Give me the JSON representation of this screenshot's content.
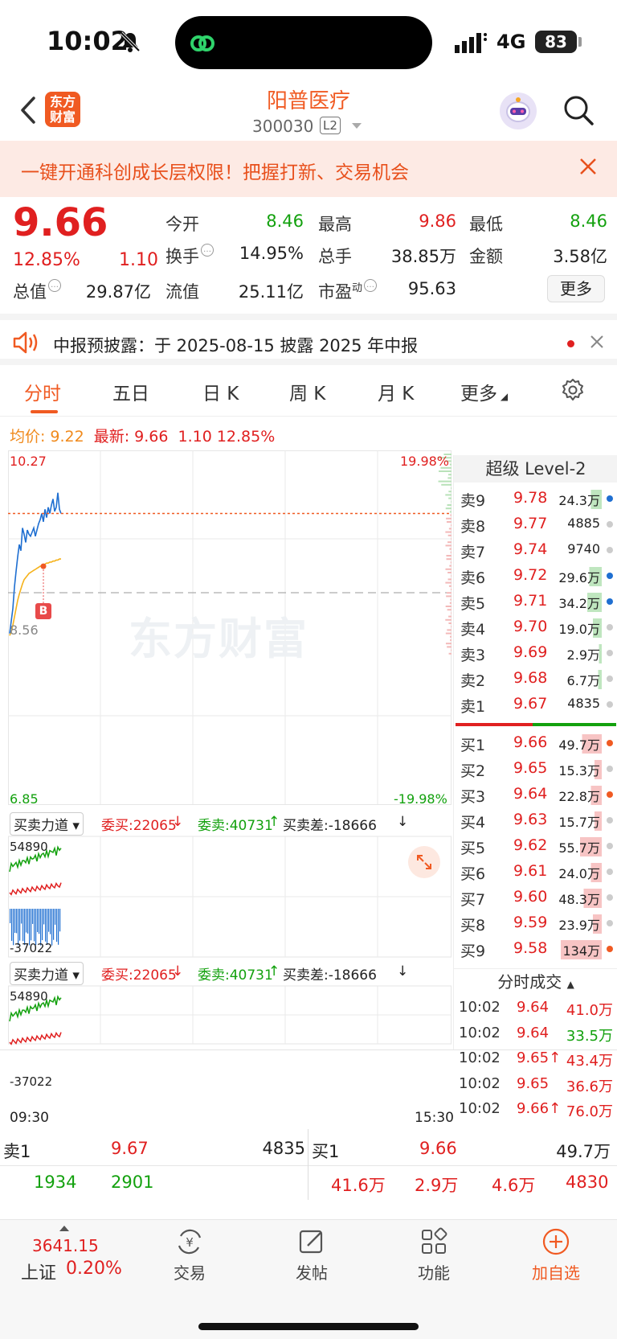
{
  "status": {
    "time": "10:02",
    "network": "4G",
    "battery": "83"
  },
  "header": {
    "logo_text": "东方财富",
    "stock_name": "阳普医疗",
    "stock_code": "300030",
    "level_tag": "L2"
  },
  "banner": {
    "text": "一键开通科创成长层权限！把握打新、交易机会"
  },
  "quote": {
    "price": "9.66",
    "change_pct": "12.85%",
    "change": "1.10",
    "open_label": "今开",
    "open": "8.46",
    "high_label": "最高",
    "high": "9.86",
    "low_label": "最低",
    "low": "8.46",
    "turnover_label": "换手",
    "turnover": "14.95%",
    "volume_label": "总手",
    "volume": "38.85万",
    "amount_label": "金额",
    "amount": "3.58亿",
    "mktcap_label": "总值",
    "mktcap": "29.87亿",
    "float_label": "流值",
    "float": "25.11亿",
    "pe_label": "市盈",
    "pe_sup": "动",
    "pe": "95.63",
    "more_label": "更多"
  },
  "notice": {
    "text": "中报预披露：于 2025-08-15 披露 2025 年中报"
  },
  "tabs": [
    "分时",
    "五日",
    "日 K",
    "周 K",
    "月 K",
    "更多"
  ],
  "avgline": {
    "avg_label": "均价:",
    "avg": "9.22",
    "last_label": "最新:",
    "last": "9.66",
    "chg": "1.10",
    "pct": "12.85%"
  },
  "chart": {
    "ymax": "10.27",
    "ymin": "6.85",
    "ymid": "8.56",
    "pct_max": "19.98%",
    "pct_min": "-19.98%",
    "watermark": "东方财富",
    "buy_marker": "B",
    "time_start": "09:30",
    "time_end": "15:30",
    "indicator": {
      "name": "买卖力道",
      "buy": "委买:22065",
      "sell": "委卖:40731",
      "diff": "买卖差:-18666",
      "top": "54890",
      "bottom": "-37022"
    }
  },
  "chart_data": {
    "type": "line",
    "x": [
      "09:30",
      "09:31",
      "09:32",
      "09:33",
      "09:34",
      "09:35",
      "09:36",
      "09:37",
      "09:38",
      "09:39",
      "09:40",
      "09:41",
      "09:42",
      "09:43",
      "09:44",
      "09:45",
      "09:46",
      "09:47",
      "09:48",
      "09:49",
      "09:50",
      "09:51",
      "09:52",
      "09:53",
      "09:54",
      "09:55",
      "09:56",
      "09:57",
      "09:58",
      "09:59",
      "10:00",
      "10:01",
      "10:02"
    ],
    "series": [
      {
        "values": [
          8.5,
          8.62,
          8.74,
          8.95,
          9.1,
          9.24,
          9.36,
          9.3,
          9.52,
          9.46,
          9.38,
          9.5,
          9.46,
          9.44,
          9.48,
          9.52,
          9.44,
          9.5,
          9.56,
          9.6,
          9.66,
          9.58,
          9.7,
          9.62,
          9.72,
          9.66,
          9.74,
          9.8,
          9.68,
          9.72,
          9.86,
          9.7,
          9.66
        ]
      },
      {
        "values": [
          8.48,
          8.52,
          8.58,
          8.66,
          8.74,
          8.82,
          8.88,
          8.93,
          8.98,
          9.02,
          9.04,
          9.06,
          9.08,
          9.09,
          9.1,
          9.11,
          9.12,
          9.13,
          9.14,
          9.15,
          9.15,
          9.16,
          9.17,
          9.18,
          9.18,
          9.19,
          9.19,
          9.2,
          9.2,
          9.21,
          9.21,
          9.22,
          9.22
        ]
      }
    ],
    "ylim": [
      6.85,
      10.27
    ]
  },
  "level2": {
    "title": "超级 Level-2",
    "asks": [
      {
        "label": "卖9",
        "price": "9.78",
        "vol": "24.3万",
        "bar": 0.12,
        "dot": "#1f6fd1"
      },
      {
        "label": "卖8",
        "price": "9.77",
        "vol": "4885",
        "bar": 0,
        "dot": "#cccccc"
      },
      {
        "label": "卖7",
        "price": "9.74",
        "vol": "9740",
        "bar": 0,
        "dot": "#cccccc"
      },
      {
        "label": "卖6",
        "price": "9.72",
        "vol": "29.6万",
        "bar": 0.14,
        "dot": "#1f6fd1"
      },
      {
        "label": "卖5",
        "price": "9.71",
        "vol": "34.2万",
        "bar": 0.16,
        "dot": "#1f6fd1"
      },
      {
        "label": "卖4",
        "price": "9.70",
        "vol": "19.0万",
        "bar": 0.1,
        "dot": "#cccccc"
      },
      {
        "label": "卖3",
        "price": "9.69",
        "vol": "2.9万",
        "bar": 0.04,
        "dot": "#cccccc"
      },
      {
        "label": "卖2",
        "price": "9.68",
        "vol": "6.7万",
        "bar": 0.05,
        "dot": "#cccccc"
      },
      {
        "label": "卖1",
        "price": "9.67",
        "vol": "4835",
        "bar": 0,
        "dot": "#cccccc"
      }
    ],
    "bids": [
      {
        "label": "买1",
        "price": "9.66",
        "vol": "49.7万",
        "bar": 0.22,
        "dot": "#f05a22"
      },
      {
        "label": "买2",
        "price": "9.65",
        "vol": "15.3万",
        "bar": 0.08,
        "dot": "#cccccc"
      },
      {
        "label": "买3",
        "price": "9.64",
        "vol": "22.8万",
        "bar": 0.12,
        "dot": "#f05a22"
      },
      {
        "label": "买4",
        "price": "9.63",
        "vol": "15.7万",
        "bar": 0.08,
        "dot": "#cccccc"
      },
      {
        "label": "买5",
        "price": "9.62",
        "vol": "55.7万",
        "bar": 0.24,
        "dot": "#cccccc"
      },
      {
        "label": "买6",
        "price": "9.61",
        "vol": "24.0万",
        "bar": 0.12,
        "dot": "#cccccc"
      },
      {
        "label": "买7",
        "price": "9.60",
        "vol": "48.3万",
        "bar": 0.2,
        "dot": "#cccccc"
      },
      {
        "label": "买8",
        "price": "9.59",
        "vol": "23.9万",
        "bar": 0.1,
        "dot": "#cccccc"
      },
      {
        "label": "买9",
        "price": "9.58",
        "vol": "134万",
        "bar": 0.5,
        "dot": "#f05a22"
      }
    ],
    "trades_title": "分时成交",
    "trades": [
      {
        "time": "10:02",
        "price": "9.64",
        "vol": "41.0万",
        "dir": "red"
      },
      {
        "time": "10:02",
        "price": "9.64",
        "vol": "33.5万",
        "dir": "green"
      },
      {
        "time": "10:02",
        "price": "9.65↑",
        "vol": "43.4万",
        "dir": "red"
      },
      {
        "time": "10:02",
        "price": "9.65",
        "vol": "36.6万",
        "dir": "red"
      },
      {
        "time": "10:02",
        "price": "9.66↑",
        "vol": "76.0万",
        "dir": "red"
      }
    ]
  },
  "summary": {
    "sell_label": "卖1",
    "sell_price": "9.67",
    "sell_vol": "4835",
    "buy_label": "买1",
    "buy_price": "9.66",
    "buy_vol": "49.7万",
    "left_a": "1934",
    "left_b": "2901",
    "right_a": "41.6万",
    "right_b": "2.9万",
    "right_c": "4.6万",
    "right_d": "4830"
  },
  "nav": {
    "index_value": "3641.15",
    "index_name": "上证",
    "index_pct": "0.20%",
    "trade": "交易",
    "post": "发帖",
    "func": "功能",
    "add": "加自选"
  },
  "colors": {
    "brand": "#f05a22",
    "up": "#e02020",
    "down": "#13a10e",
    "price_line": "#1f6fd1",
    "avg_line": "#f5b21b"
  }
}
